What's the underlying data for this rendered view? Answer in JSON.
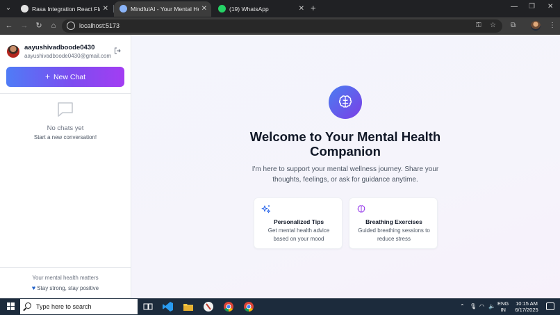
{
  "browser": {
    "tabs": [
      {
        "title": "Rasa Integration React Flask",
        "favicon": "github-icon",
        "active": false
      },
      {
        "title": "MindfulAI - Your Mental Health",
        "favicon": "globe-icon",
        "active": true
      },
      {
        "title": "(19) WhatsApp",
        "favicon": "whatsapp-icon",
        "active": false
      }
    ],
    "url": "localhost:5173"
  },
  "sidebar": {
    "username": "aayushivadboode0430",
    "email": "aayushivadboode0430@gmail.com",
    "new_chat_label": "New Chat",
    "empty_title": "No chats yet",
    "empty_subtitle": "Start a new conversation!",
    "footer_line1": "Your mental health matters",
    "footer_line2": "Stay strong, stay positive"
  },
  "main": {
    "headline": "Welcome to Your Mental Health Companion",
    "intro": "I'm here to support your mental wellness journey. Share your thoughts, feelings, or ask for guidance anytime.",
    "cards": [
      {
        "title": "Personalized Tips",
        "description": "Get mental health advice based on your mood",
        "icon": "sparkles-icon"
      },
      {
        "title": "Breathing Exercises",
        "description": "Guided breathing sessions to reduce stress",
        "icon": "brain-icon"
      }
    ]
  },
  "taskbar": {
    "search_placeholder": "Type here to search",
    "lang_line1": "ENG",
    "lang_line2": "IN",
    "time": "10:15 AM",
    "date": "6/17/2025"
  },
  "colors": {
    "accent_start": "#4f7cf6",
    "accent_end": "#a33df2",
    "taskbar": "#1c2b3c"
  }
}
